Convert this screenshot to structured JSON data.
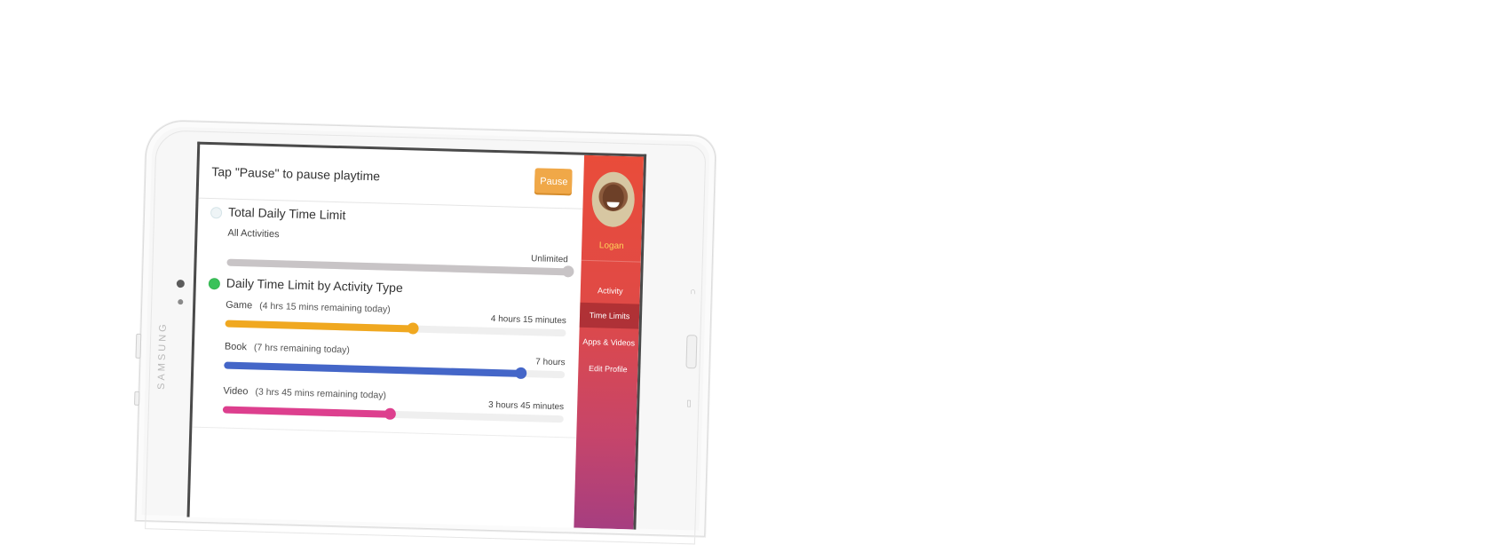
{
  "device": {
    "brand": "SAMSUNG"
  },
  "topbar": {
    "instruction": "Tap \"Pause\" to pause playtime",
    "pause_label": "Pause"
  },
  "total_limit": {
    "title": "Total Daily Time Limit",
    "enabled": false,
    "row_label": "All Activities",
    "value_label": "Unlimited",
    "level": 1.0,
    "color": "#c8c4c6"
  },
  "activity_limit": {
    "title": "Daily Time Limit by Activity Type",
    "enabled": true,
    "rows": [
      {
        "name": "Game",
        "remaining": "(4 hrs 15 mins remaining today)",
        "value_label": "4 hours 15 minutes",
        "level": 0.55,
        "color": "#f0a820"
      },
      {
        "name": "Book",
        "remaining": "(7 hrs remaining today)",
        "value_label": "7 hours",
        "level": 0.87,
        "color": "#4466c8"
      },
      {
        "name": "Video",
        "remaining": "(3 hrs 45 mins remaining today)",
        "value_label": "3 hours 45 minutes",
        "level": 0.49,
        "color": "#dd3f8e"
      }
    ]
  },
  "sidebar": {
    "username": "Logan",
    "items": [
      {
        "label": "Activity",
        "active": false
      },
      {
        "label": "Time Limits",
        "active": true
      },
      {
        "label": "Apps & Videos",
        "active": false
      },
      {
        "label": "Edit Profile",
        "active": false
      }
    ]
  }
}
